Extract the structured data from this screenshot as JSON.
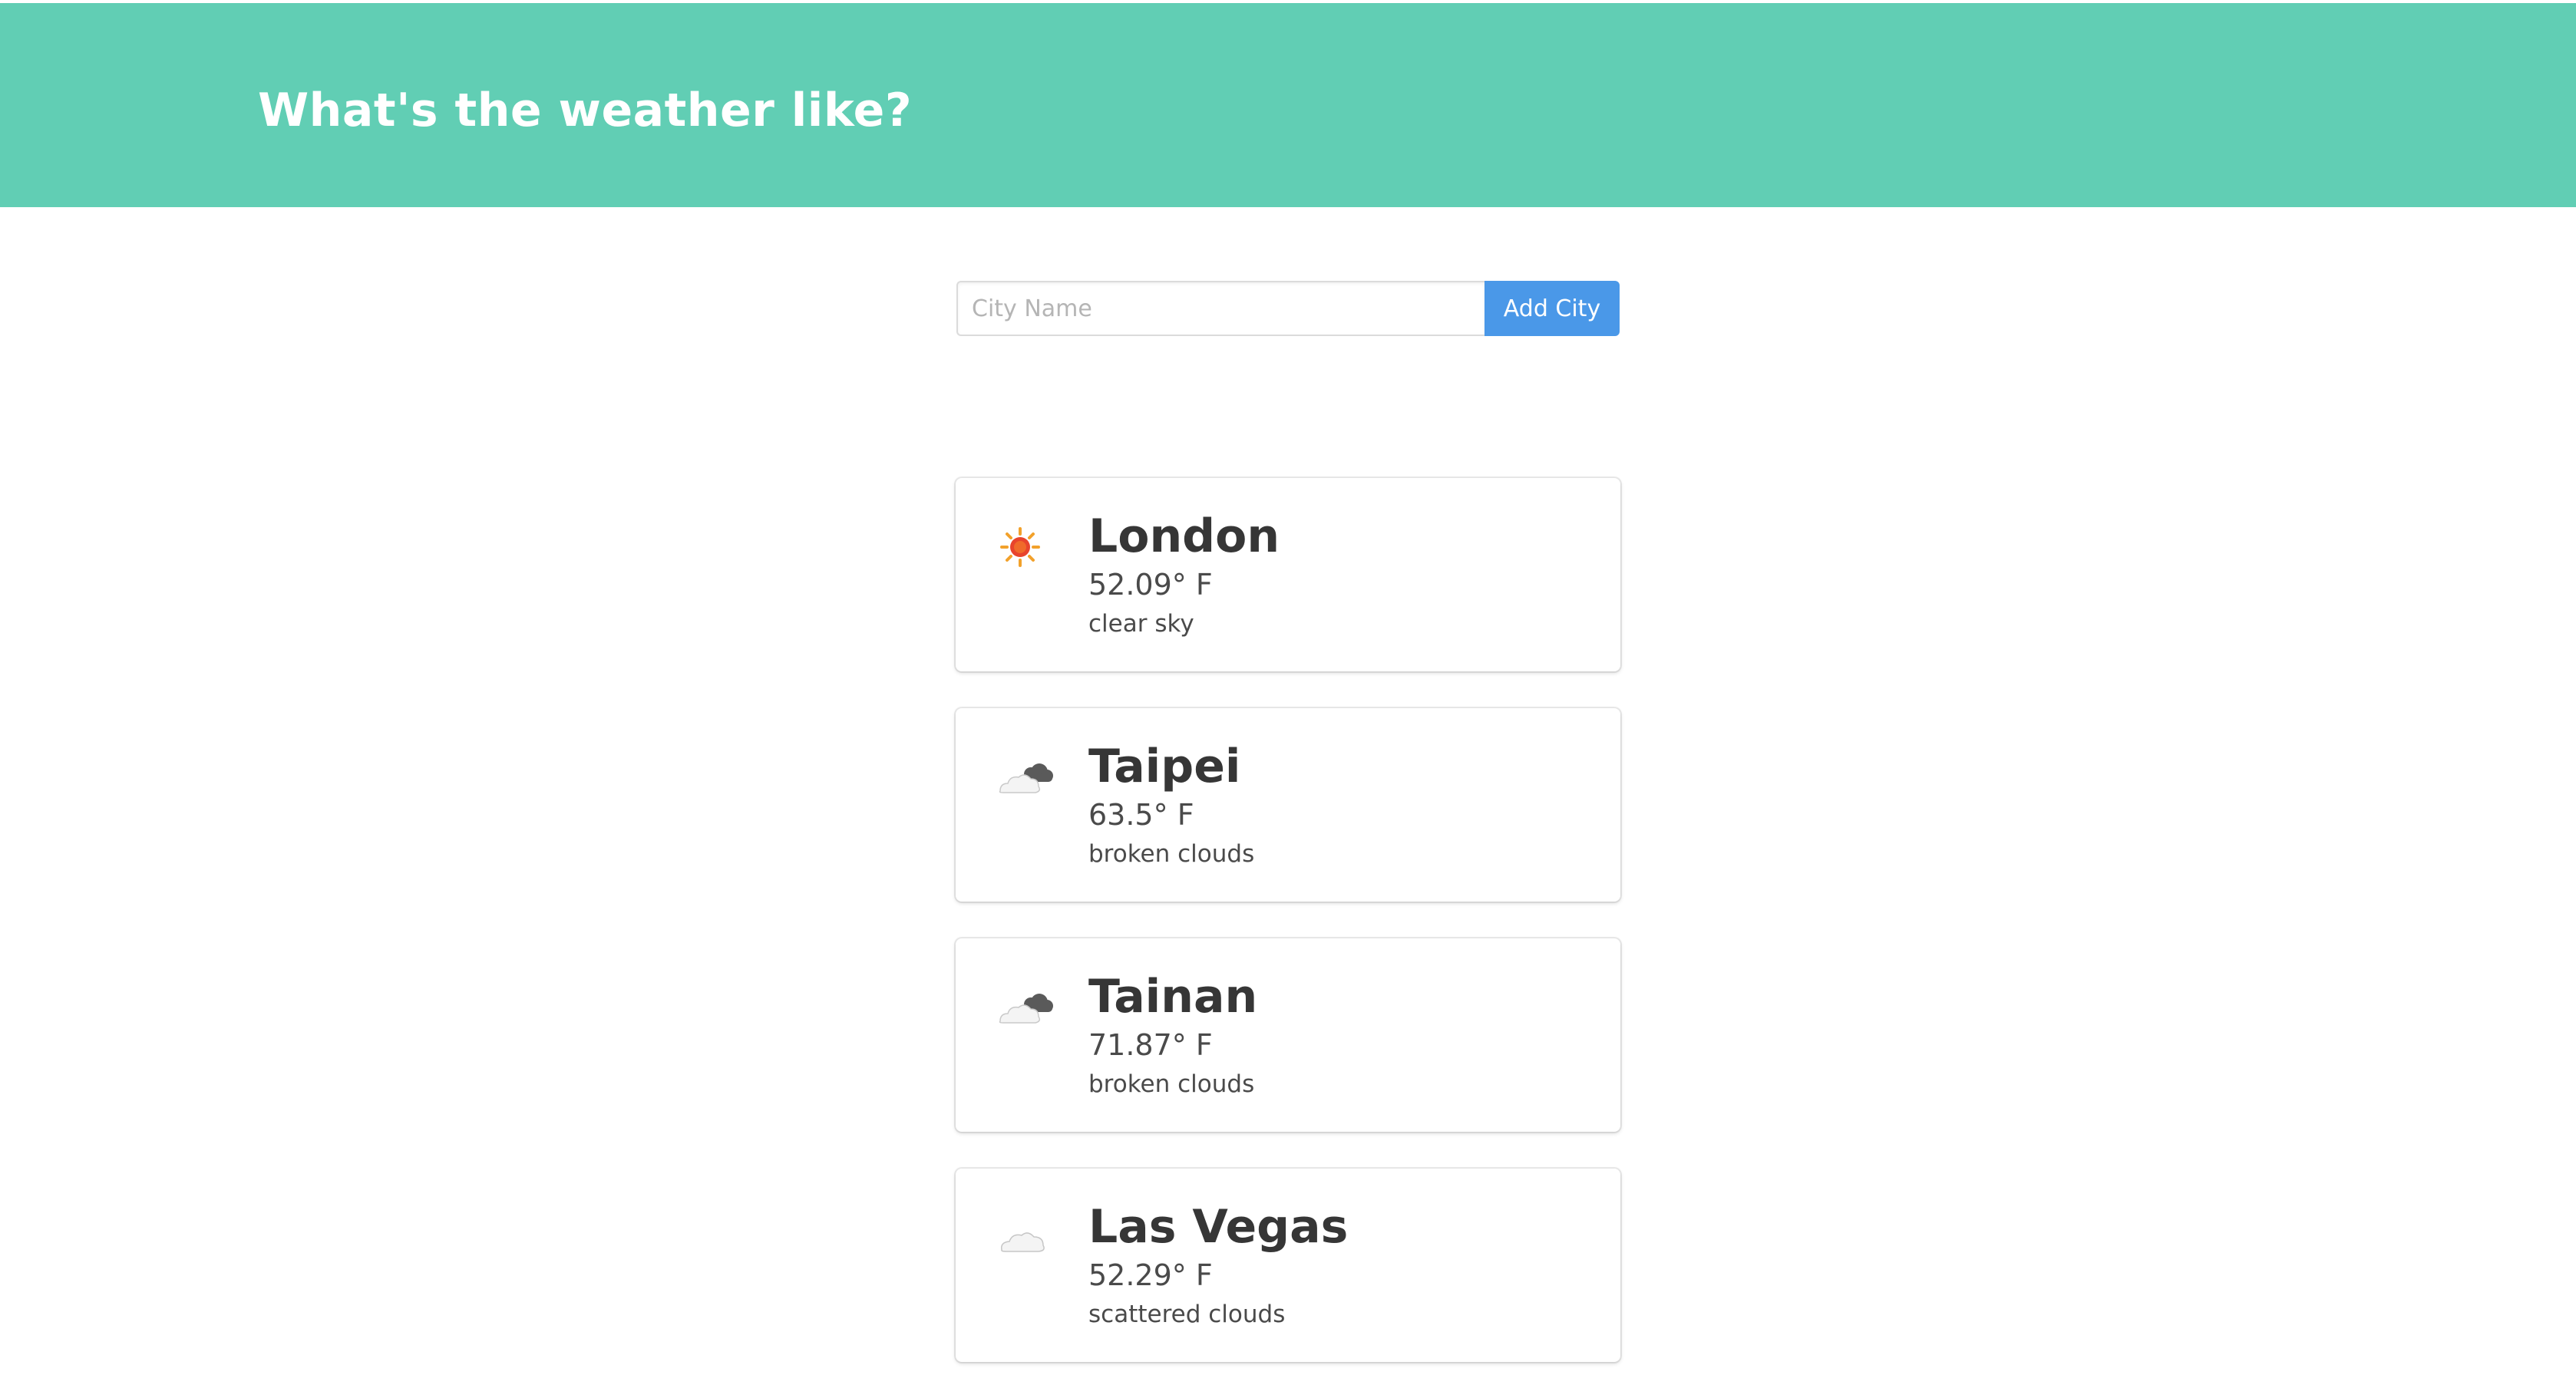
{
  "header": {
    "title": "What's the weather like?",
    "background_color": "#61ceb4"
  },
  "search": {
    "placeholder": "City Name",
    "value": "",
    "button_label": "Add City",
    "button_color": "#4a98e8"
  },
  "cities": [
    {
      "name": "London",
      "temperature": "52.09° F",
      "description": "clear sky",
      "icon": "sun-icon"
    },
    {
      "name": "Taipei",
      "temperature": "63.5° F",
      "description": "broken clouds",
      "icon": "broken-clouds-icon"
    },
    {
      "name": "Tainan",
      "temperature": "71.87° F",
      "description": "broken clouds",
      "icon": "broken-clouds-icon"
    },
    {
      "name": "Las Vegas",
      "temperature": "52.29° F",
      "description": "scattered clouds",
      "icon": "scattered-clouds-icon"
    }
  ]
}
